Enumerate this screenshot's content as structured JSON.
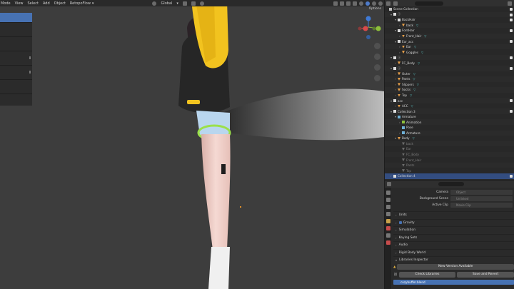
{
  "viewport": {
    "menu": [
      "Mode",
      "View",
      "Select",
      "Add",
      "Object",
      "RetopoFlow"
    ],
    "orientation": "Global",
    "options": "Options"
  },
  "outliner": {
    "search_placeholder": "",
    "rows": [
      {
        "label": "Scene Collection",
        "indent": 0,
        "kind": "scene"
      },
      {
        "label": "ⓘ",
        "indent": 1,
        "kind": "collection",
        "caret": "▾"
      },
      {
        "label": "BackHair",
        "indent": 2,
        "kind": "collection",
        "caret": "▾"
      },
      {
        "label": "back",
        "indent": 3,
        "kind": "mesh",
        "caret": "›"
      },
      {
        "label": "FontHair",
        "indent": 2,
        "kind": "collection",
        "caret": "▾"
      },
      {
        "label": "Front_Hair",
        "indent": 3,
        "kind": "mesh",
        "caret": "›"
      },
      {
        "label": "Ear_acc",
        "indent": 2,
        "kind": "collection",
        "caret": "▾"
      },
      {
        "label": "Ear",
        "indent": 3,
        "kind": "mesh",
        "caret": "›"
      },
      {
        "label": "Goggles",
        "indent": 3,
        "kind": "mesh",
        "caret": "›"
      },
      {
        "label": "ⓘ",
        "indent": 1,
        "kind": "collection",
        "caret": "▾"
      },
      {
        "label": "FC_Body",
        "indent": 2,
        "kind": "mesh",
        "caret": "›"
      },
      {
        "label": "ⓘ",
        "indent": 1,
        "kind": "collection",
        "caret": "▾"
      },
      {
        "label": "Outer",
        "indent": 2,
        "kind": "mesh",
        "caret": "›"
      },
      {
        "label": "Pants",
        "indent": 2,
        "kind": "mesh",
        "caret": "›"
      },
      {
        "label": "Slippers",
        "indent": 2,
        "kind": "mesh",
        "caret": "›"
      },
      {
        "label": "Socks",
        "indent": 2,
        "kind": "mesh",
        "caret": "›"
      },
      {
        "label": "Top",
        "indent": 2,
        "kind": "mesh",
        "caret": "›"
      },
      {
        "label": "acc",
        "indent": 1,
        "kind": "collection",
        "caret": "▾"
      },
      {
        "label": "ACC",
        "indent": 2,
        "kind": "mesh",
        "caret": "›"
      },
      {
        "label": "Collection 3",
        "indent": 1,
        "kind": "collection",
        "caret": "▾"
      },
      {
        "label": "Armature",
        "indent": 2,
        "kind": "armature",
        "caret": "▾"
      },
      {
        "label": "Animation",
        "indent": 3,
        "kind": "anim",
        "caret": "›"
      },
      {
        "label": "Pose",
        "indent": 3,
        "kind": "pose",
        "caret": ""
      },
      {
        "label": "Armature",
        "indent": 3,
        "kind": "armature",
        "caret": "›"
      },
      {
        "label": "Body",
        "indent": 2,
        "kind": "mesh",
        "caret": "▾"
      },
      {
        "label": "back",
        "indent": 3,
        "kind": "dim",
        "caret": ""
      },
      {
        "label": "Ear",
        "indent": 3,
        "kind": "dim",
        "caret": ""
      },
      {
        "label": "FC_Body",
        "indent": 3,
        "kind": "dim",
        "caret": ""
      },
      {
        "label": "Front_Hair",
        "indent": 3,
        "kind": "dim",
        "caret": ""
      },
      {
        "label": "Pants",
        "indent": 3,
        "kind": "dim",
        "caret": ""
      },
      {
        "label": "Top",
        "indent": 3,
        "kind": "dim",
        "caret": ""
      },
      {
        "label": "Collection 4",
        "indent": 1,
        "kind": "collection",
        "caret": "›",
        "selected": true
      }
    ]
  },
  "properties": {
    "search_placeholder": "",
    "fields": [
      {
        "label": "Camera",
        "value": "Object"
      },
      {
        "label": "Background Scene",
        "value": "Unlinked"
      },
      {
        "label": "Active Clip",
        "value": "Movie Clip"
      }
    ],
    "panels": [
      "Units",
      "Gravity",
      "Simulation",
      "Keying Sets",
      "Audio",
      "Rigid Body World",
      "Libraries Inspector"
    ],
    "new_version": "New Version Available",
    "check_libraries": "Check Libraries",
    "save_and_revert": "Save and Revert",
    "file_name": "cozybuffer.blend"
  },
  "colors": {
    "viewport_bg": "#3d3d3d",
    "selection": "#4772b3",
    "jacket_yellow": "#f2c31f",
    "jacket_black": "#262626",
    "skin": "#f1cfc8"
  }
}
